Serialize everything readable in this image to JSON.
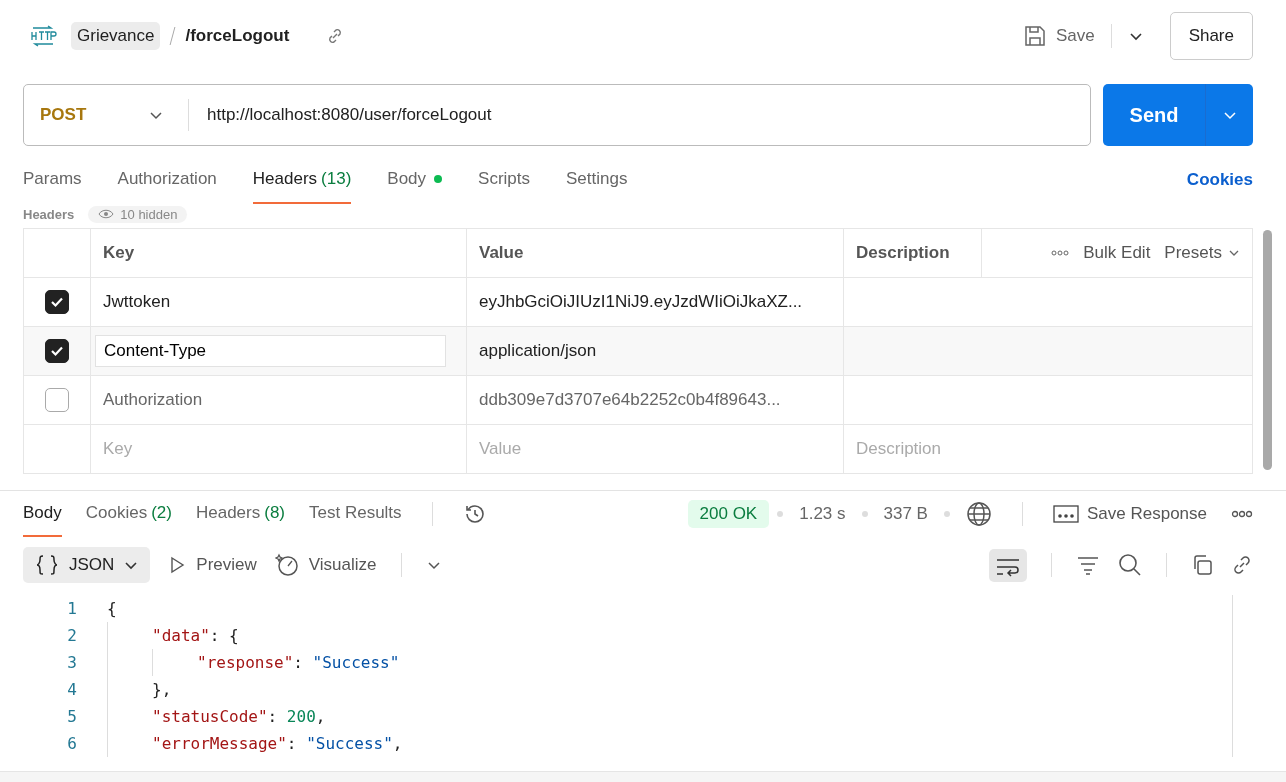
{
  "breadcrumb": {
    "collection": "Grievance",
    "request": "/forceLogout"
  },
  "actions": {
    "save": "Save",
    "share": "Share"
  },
  "request": {
    "method": "POST",
    "url": "http://localhost:8080/user/forceLogout",
    "send": "Send"
  },
  "request_tabs": [
    {
      "label": "Params",
      "selected": false
    },
    {
      "label": "Authorization",
      "selected": false
    },
    {
      "label": "Headers",
      "count": "(13)",
      "selected": true
    },
    {
      "label": "Body",
      "dot": true,
      "selected": false
    },
    {
      "label": "Scripts",
      "selected": false
    },
    {
      "label": "Settings",
      "selected": false
    }
  ],
  "cookies_link": "Cookies",
  "headers_bar": {
    "title": "Headers",
    "hidden": "10 hidden"
  },
  "headers_table": {
    "columns": [
      "Key",
      "Value",
      "Description"
    ],
    "bulk_edit": "Bulk Edit",
    "presets": "Presets",
    "rows": [
      {
        "checked": true,
        "key": "Jwttoken",
        "value": "eyJhbGciOiJIUzI1NiJ9.eyJzdWIiOiJkaXZ...",
        "editing": false
      },
      {
        "checked": true,
        "key": "Content-Type",
        "value": "application/json",
        "editing": true
      },
      {
        "checked": false,
        "key": "Authorization",
        "value": "ddb309e7d3707e64b2252c0b4f89643...",
        "editing": false
      }
    ],
    "empty_row": [
      {
        "placeholder": "Key"
      },
      {
        "placeholder": "Value"
      },
      {
        "placeholder": "Description"
      }
    ]
  },
  "response_tabs": [
    {
      "label": "Body",
      "selected": true
    },
    {
      "label": "Cookies",
      "count": "(2)",
      "selected": false
    },
    {
      "label": "Headers",
      "count": "(8)",
      "selected": false
    },
    {
      "label": "Test Results",
      "selected": false
    }
  ],
  "response_meta": {
    "status": "200 OK",
    "time": "1.23 s",
    "size": "337 B",
    "save_response": "Save Response"
  },
  "body_toolbar": {
    "format": "JSON",
    "preview": "Preview",
    "visualize": "Visualize"
  },
  "code_lines": [
    {
      "number": "1",
      "tokens": [
        {
          "kind": "punct",
          "text": "{"
        }
      ],
      "children": [
        {
          "number": "2",
          "tokens": [
            {
              "kind": "key",
              "text": "\"data\""
            },
            {
              "kind": "punct",
              "text": ": {"
            }
          ],
          "children": [
            {
              "number": "3",
              "tokens": [
                {
                  "kind": "key",
                  "text": "\"response\""
                },
                {
                  "kind": "punct",
                  "text": ": "
                },
                {
                  "kind": "str",
                  "text": "\"Success\""
                }
              ]
            }
          ]
        },
        {
          "number": "4",
          "tokens": [
            {
              "kind": "punct",
              "text": "},"
            }
          ]
        },
        {
          "number": "5",
          "tokens": [
            {
              "kind": "key",
              "text": "\"statusCode\""
            },
            {
              "kind": "punct",
              "text": ": "
            },
            {
              "kind": "num",
              "text": "200"
            },
            {
              "kind": "punct",
              "text": ","
            }
          ]
        },
        {
          "number": "6",
          "tokens": [
            {
              "kind": "key",
              "text": "\"errorMessage\""
            },
            {
              "kind": "punct",
              "text": ": "
            },
            {
              "kind": "str",
              "text": "\"Success\""
            },
            {
              "kind": "punct",
              "text": ","
            }
          ]
        }
      ]
    }
  ]
}
